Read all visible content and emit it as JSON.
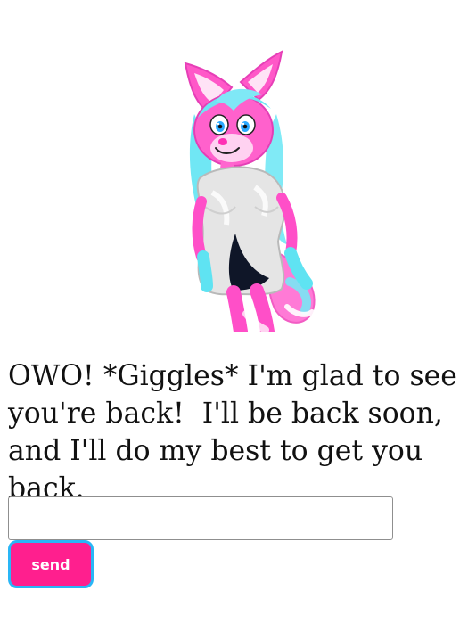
{
  "message": {
    "text": "OWO! *Giggles* I'm glad to see you're back!  I'll be back soon, and I'll do my best to get you back."
  },
  "chat": {
    "input_value": "",
    "input_placeholder": "",
    "send_label": "send"
  },
  "colors": {
    "send_background": "#ff1f8e",
    "send_border": "#29b6f6",
    "fur_pink": "#ff4fc8",
    "hair_cyan": "#5fe3f2",
    "dress_white": "#e6e6e6",
    "dress_dark": "#0d1426"
  },
  "character": {
    "icon": "fox-girl-illustration"
  }
}
